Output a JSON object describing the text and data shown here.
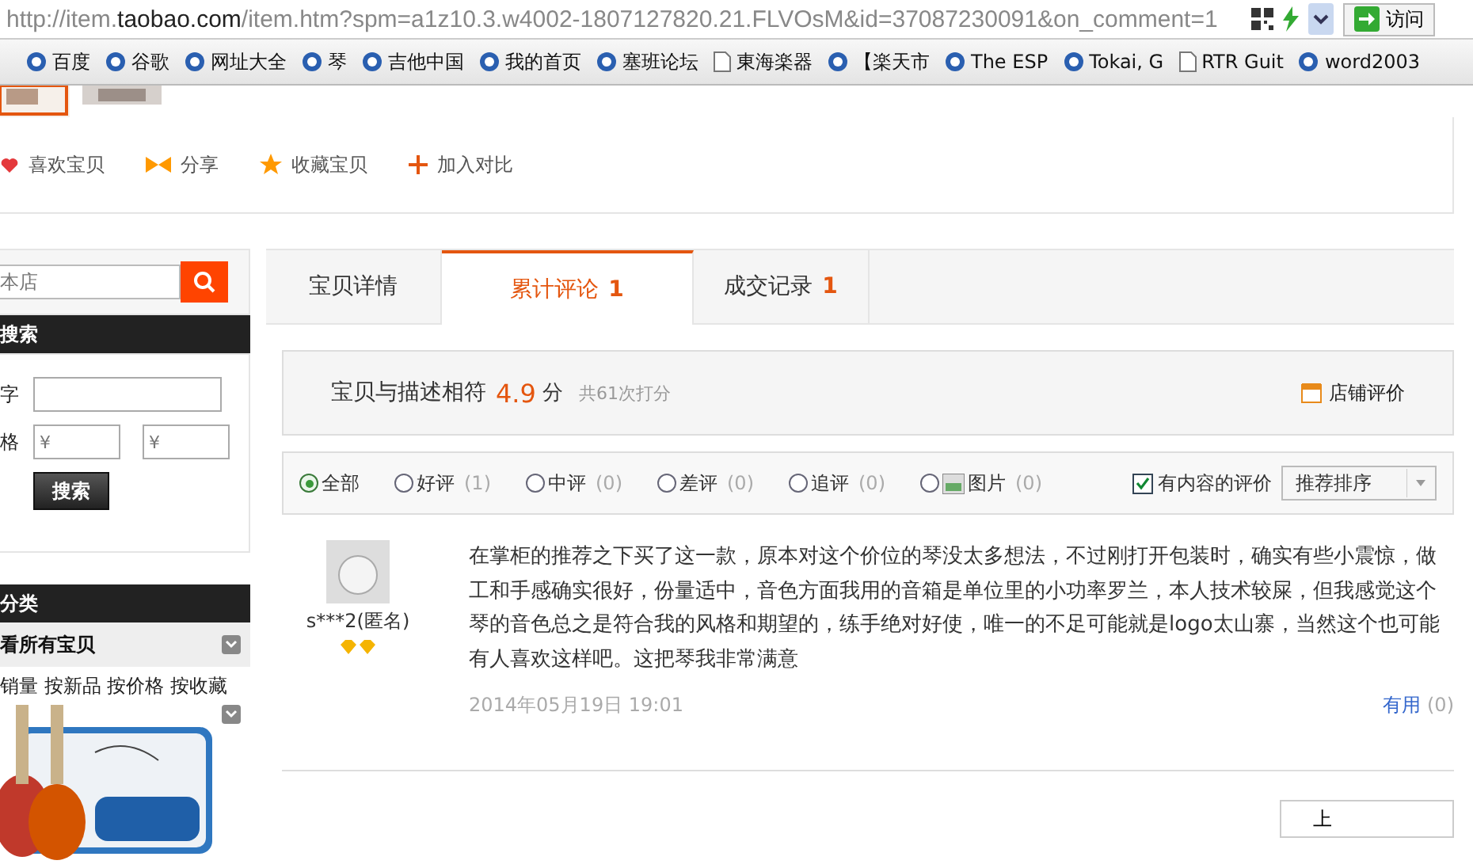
{
  "address_bar": {
    "url_prefix": "http://item.",
    "url_domain": "taobao.com",
    "url_rest": "/item.htm?spm=a1z10.3.w4002-1807127820.21.FLVOsM&id=37087230091&on_comment=1",
    "go_label": "访问"
  },
  "bookmarks": [
    {
      "label": "百度",
      "kind": "site"
    },
    {
      "label": "谷歌",
      "kind": "site"
    },
    {
      "label": "网址大全",
      "kind": "site"
    },
    {
      "label": "琴",
      "kind": "site"
    },
    {
      "label": "吉他中国",
      "kind": "site"
    },
    {
      "label": "我的首页",
      "kind": "site"
    },
    {
      "label": "塞班论坛",
      "kind": "site"
    },
    {
      "label": "東海楽器",
      "kind": "page"
    },
    {
      "label": "【楽天市",
      "kind": "site"
    },
    {
      "label": "The ESP",
      "kind": "site"
    },
    {
      "label": "Tokai, G",
      "kind": "site"
    },
    {
      "label": "RTR Guit",
      "kind": "page"
    },
    {
      "label": "word2003",
      "kind": "site"
    }
  ],
  "actions": [
    {
      "label": "喜欢宝贝",
      "kind": "heart"
    },
    {
      "label": "分享",
      "kind": "share"
    },
    {
      "label": "收藏宝贝",
      "kind": "star"
    },
    {
      "label": "加入对比",
      "kind": "plus"
    }
  ],
  "sidebar": {
    "search_placeholder": "本店",
    "search_title": "搜索",
    "keyword_label": "字",
    "price_label": "格",
    "price_placeholders": [
      "¥",
      "¥"
    ],
    "search_button": "搜索",
    "category_title": "分类",
    "all_items": "看所有宝贝",
    "sort_links": "销量 按新品 按价格 按收藏"
  },
  "tabs": [
    {
      "label": "宝贝详情",
      "selected": false
    },
    {
      "label": "累计评论",
      "count": "1",
      "selected": true
    },
    {
      "label": "成交记录",
      "count": "1",
      "selected": false
    }
  ],
  "rating": {
    "label": "宝贝与描述相符",
    "score": "4.9",
    "unit": "分",
    "total": "共61次打分",
    "shop_link": "店铺评价"
  },
  "filters": [
    {
      "label": "全部",
      "selected": true
    },
    {
      "label": "好评",
      "count": "(1)",
      "selected": false
    },
    {
      "label": "中评",
      "count": "(0)",
      "selected": false
    },
    {
      "label": "差评",
      "count": "(0)",
      "selected": false
    },
    {
      "label": "追评",
      "count": "(0)",
      "selected": false
    },
    {
      "label": "图片",
      "count": "(0)",
      "selected": false,
      "kind": "picture"
    }
  ],
  "content_only": {
    "label": "有内容的评价",
    "checked": true
  },
  "sort_select": {
    "value": "推荐排序"
  },
  "reviews": [
    {
      "user": "s***2(匿名)",
      "text": "在掌柜的推荐之下买了这一款，原本对这个价位的琴没太多想法，不过刚打开包装时，确实有些小震惊，做工和手感确实很好，份量适中，音色方面我用的音箱是单位里的小功率罗兰，本人技术较屎，但我感觉这个琴的音色总之是符合我的风格和期望的，练手绝对好使，唯一的不足可能就是logo太山寨，当然这个也可能有人喜欢这样吧。这把琴我非常满意",
      "date": "2014年05月19日 19:01",
      "useful": "有用",
      "useful_count": "(0)"
    }
  ],
  "pager": {
    "prev": "上"
  }
}
